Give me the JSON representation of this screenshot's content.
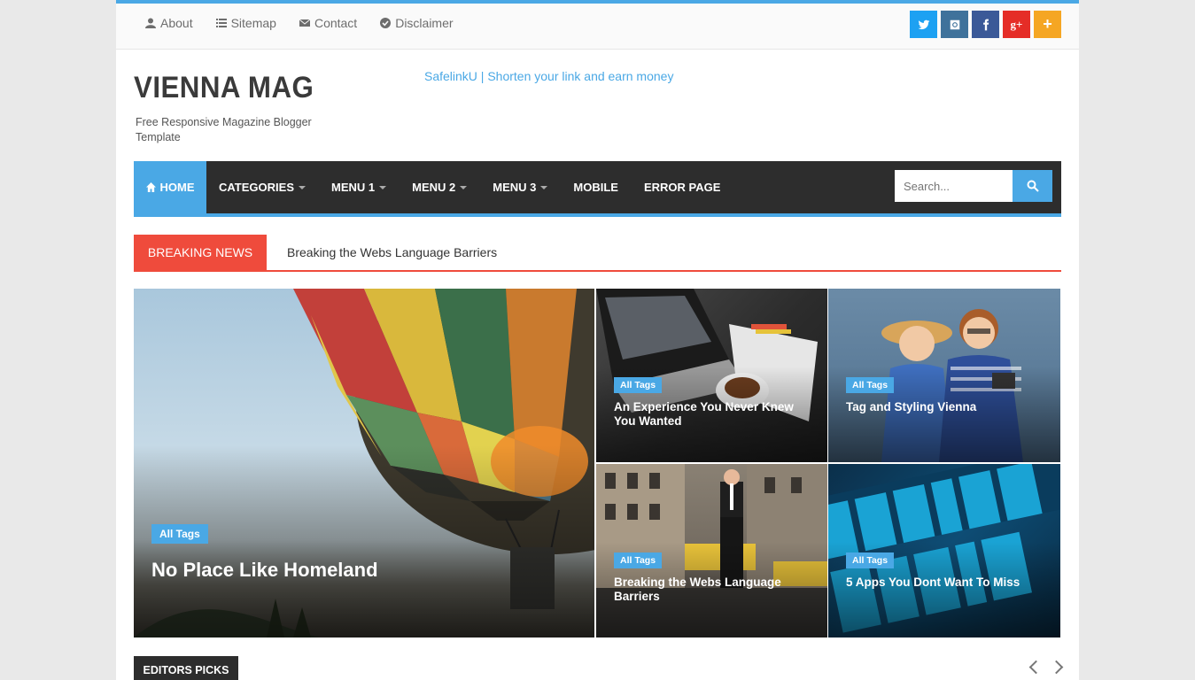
{
  "topbar": {
    "links": [
      {
        "label": "About",
        "icon": "user-icon"
      },
      {
        "label": "Sitemap",
        "icon": "list-icon"
      },
      {
        "label": "Contact",
        "icon": "envelope-icon"
      },
      {
        "label": "Disclaimer",
        "icon": "check-circle-icon"
      }
    ],
    "social": [
      {
        "name": "twitter-icon",
        "color": "#1da1f2"
      },
      {
        "name": "instagram-icon",
        "color": "#3f729b"
      },
      {
        "name": "facebook-icon",
        "color": "#3b5998"
      },
      {
        "name": "google-plus-icon",
        "color": "#e52d27"
      },
      {
        "name": "plus-icon",
        "color": "#f5a623"
      }
    ]
  },
  "header": {
    "logo": "VIENNA MAG",
    "tagline": "Free Responsive Magazine Blogger Template",
    "promo": "SafelinkU | Shorten your link and earn money"
  },
  "nav": {
    "home": "HOME",
    "items": [
      {
        "label": "CATEGORIES",
        "dropdown": true
      },
      {
        "label": "MENU 1",
        "dropdown": true
      },
      {
        "label": "MENU 2",
        "dropdown": true
      },
      {
        "label": "MENU 3",
        "dropdown": true
      },
      {
        "label": "MOBILE",
        "dropdown": false
      },
      {
        "label": "ERROR PAGE",
        "dropdown": false
      }
    ],
    "search_placeholder": "Search..."
  },
  "breaking": {
    "label": "BREAKING NEWS",
    "headline": "Breaking the Webs Language Barriers"
  },
  "featured": {
    "main": {
      "tag": "All Tags",
      "title": "No Place Like Homeland"
    },
    "tiles": [
      {
        "tag": "All Tags",
        "title": "An Experience You Never Knew You Wanted"
      },
      {
        "tag": "All Tags",
        "title": "Tag and Styling Vienna"
      },
      {
        "tag": "All Tags",
        "title": "Breaking the Webs Language Barriers"
      },
      {
        "tag": "All Tags",
        "title": "5 Apps You Dont Want To Miss"
      }
    ]
  },
  "editors_picks": {
    "label": "EDITORS PICKS"
  },
  "colors": {
    "accent": "#4aa8e5",
    "breaking": "#ef4b3c",
    "nav": "#2d2d2d"
  }
}
